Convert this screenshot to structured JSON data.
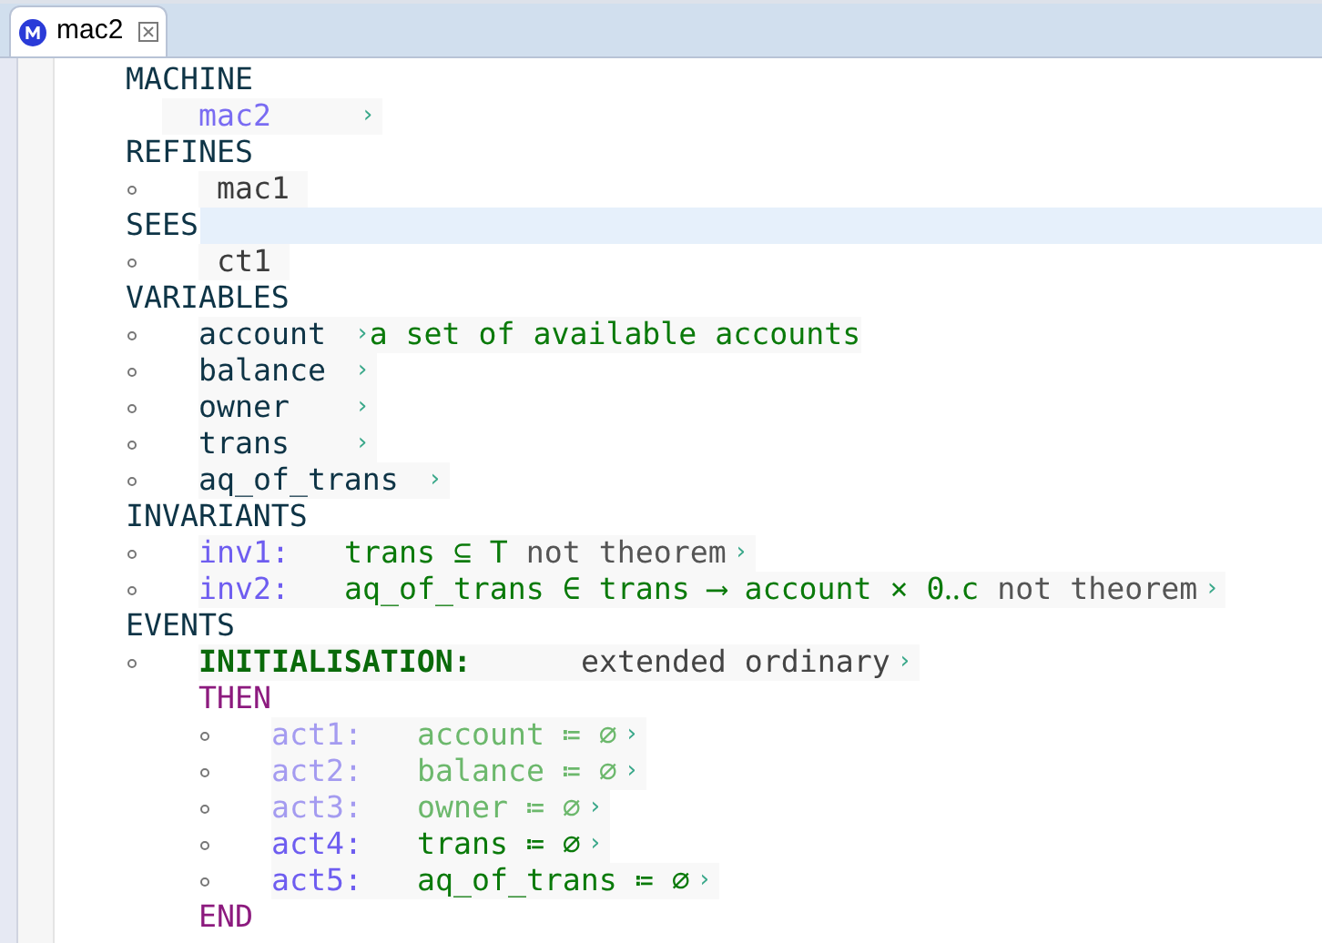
{
  "tab": {
    "title": "mac2",
    "selected": true
  },
  "sections": [
    {
      "keyword": "MACHINE",
      "current": false,
      "items": [
        {
          "kind": "name",
          "name": "mac2",
          "more": "›"
        }
      ]
    },
    {
      "keyword": "REFINES",
      "current": false,
      "items": [
        {
          "kind": "ref",
          "name": "mac1"
        }
      ]
    },
    {
      "keyword": "SEES",
      "current": true,
      "items": [
        {
          "kind": "ref",
          "name": "ct1"
        }
      ]
    },
    {
      "keyword": "VARIABLES",
      "current": false,
      "items": [
        {
          "kind": "variable",
          "name": "account",
          "more": "›",
          "comment": "a set of available accounts"
        },
        {
          "kind": "variable",
          "name": "balance",
          "more": "›"
        },
        {
          "kind": "variable",
          "name": "owner",
          "more": "›"
        },
        {
          "kind": "variable",
          "name": "trans",
          "more": "›"
        },
        {
          "kind": "variable",
          "name": "aq_of_trans",
          "more": "›"
        }
      ]
    },
    {
      "keyword": "INVARIANTS",
      "current": false,
      "items": [
        {
          "kind": "invariant",
          "label": "inv1:",
          "predicate": "trans ⊆ T",
          "flag": "not theorem",
          "more": "›"
        },
        {
          "kind": "invariant",
          "label": "inv2:",
          "predicate": "aq_of_trans ∈ trans ⟶ account × 0‥c",
          "flag": "not theorem",
          "more": "›"
        }
      ]
    },
    {
      "keyword": "EVENTS",
      "current": false,
      "items": [
        {
          "kind": "event",
          "label": "INITIALISATION:",
          "status": "extended ordinary",
          "more": "›",
          "then": "THEN",
          "end": "END",
          "actions": [
            {
              "label": "act1:",
              "assignment": "account ≔ ∅",
              "more": "›",
              "inherited": true
            },
            {
              "label": "act2:",
              "assignment": "balance ≔ ∅",
              "more": "›",
              "inherited": true
            },
            {
              "label": "act3:",
              "assignment": "owner ≔ ∅",
              "more": "›",
              "inherited": true
            },
            {
              "label": "act4:",
              "assignment": "trans ≔ ∅",
              "more": "›",
              "inherited": false
            },
            {
              "label": "act5:",
              "assignment": "aq_of_trans ≔ ∅",
              "more": "›",
              "inherited": false
            }
          ]
        }
      ]
    }
  ]
}
